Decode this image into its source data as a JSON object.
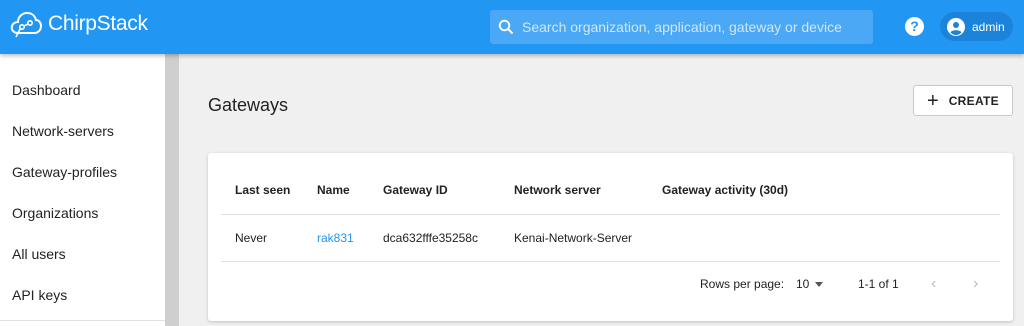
{
  "header": {
    "app_name": "ChirpStack",
    "search": {
      "placeholder": "Search organization, application, gateway or device"
    },
    "help_icon": "?",
    "user": {
      "name": "admin"
    }
  },
  "sidebar": {
    "items": [
      {
        "label": "Dashboard"
      },
      {
        "label": "Network-servers"
      },
      {
        "label": "Gateway-profiles"
      },
      {
        "label": "Organizations"
      },
      {
        "label": "All users"
      },
      {
        "label": "API keys"
      }
    ]
  },
  "main": {
    "title": "Gateways",
    "create_button": {
      "icon": "+",
      "label": "CREATE"
    },
    "table": {
      "columns": [
        "Last seen",
        "Name",
        "Gateway ID",
        "Network server",
        "Gateway activity (30d)"
      ],
      "rows": [
        {
          "last_seen": "Never",
          "name": "rak831",
          "gateway_id": "dca632fffe35258c",
          "network_server": "Kenai-Network-Server"
        }
      ]
    },
    "pagination": {
      "rows_per_page_label": "Rows per page:",
      "rows_per_page": "10",
      "range": "1-1 of 1",
      "prev_icon": "‹",
      "next_icon": "›"
    }
  },
  "colors": {
    "primary": "#2196f3",
    "link": "#2196f3"
  }
}
